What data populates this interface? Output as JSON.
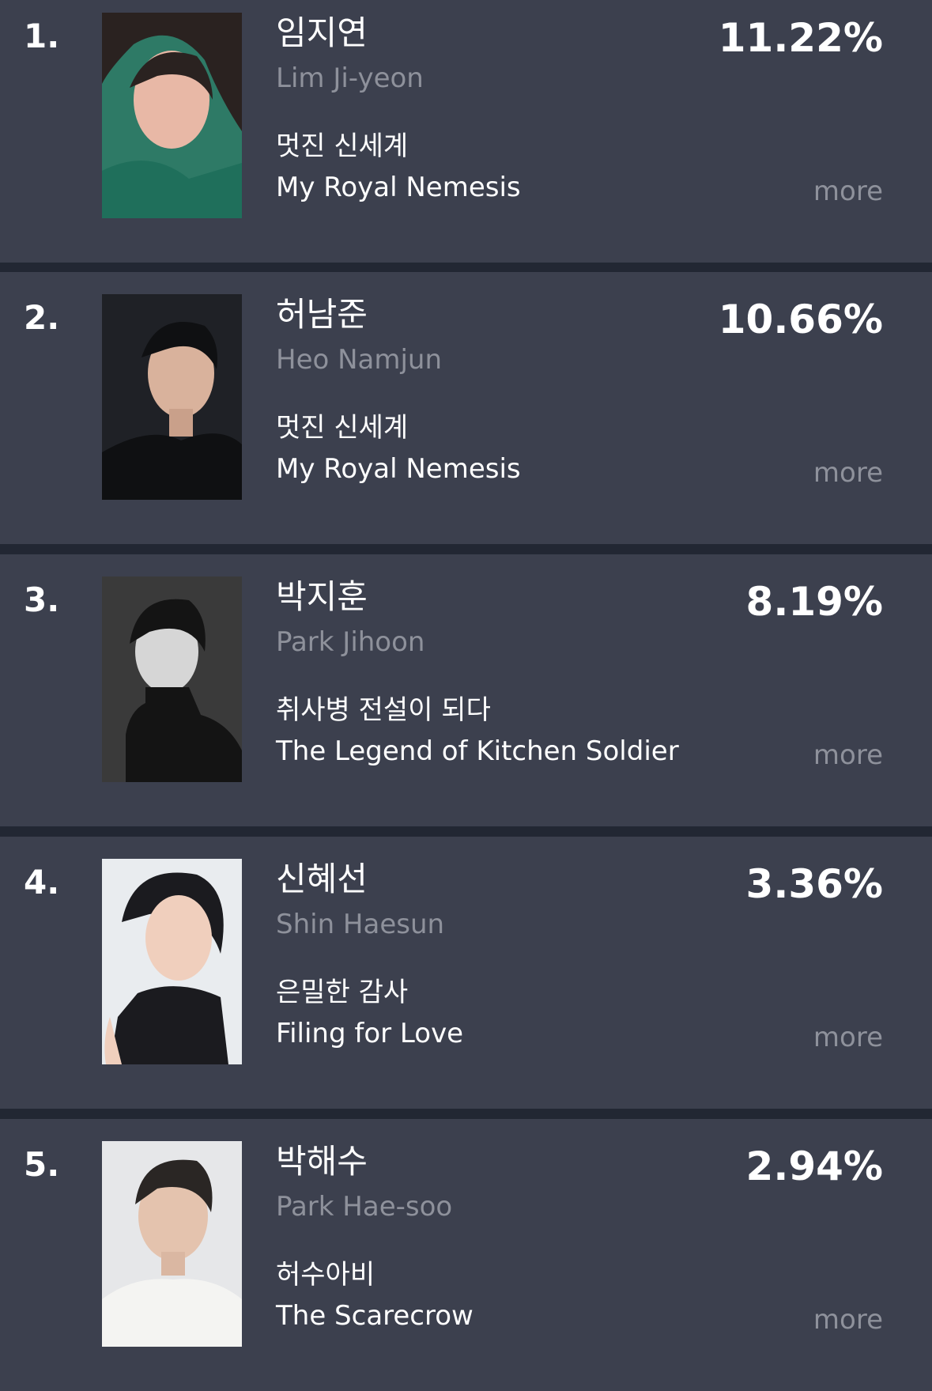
{
  "ranking": [
    {
      "rank": "1.",
      "name_ko": "임지연",
      "name_en": "Lim Ji-yeon",
      "show_ko": "멋진 신세계",
      "show_en": "My Royal Nemesis",
      "percent": "11.22%",
      "more": "more",
      "photo_bg": "#2e7a66",
      "photo_subject": "#2a2220"
    },
    {
      "rank": "2.",
      "name_ko": "허남준",
      "name_en": "Heo Namjun",
      "show_ko": "멋진 신세계",
      "show_en": "My Royal Nemesis",
      "percent": "10.66%",
      "more": "more",
      "photo_bg": "#1f2126",
      "photo_subject": "#0f1012"
    },
    {
      "rank": "3.",
      "name_ko": "박지훈",
      "name_en": "Park Jihoon",
      "show_ko": "취사병 전설이 되다",
      "show_en": "The Legend of Kitchen Soldier",
      "percent": "8.19%",
      "more": "more",
      "photo_bg": "#3a3a3a",
      "photo_subject": "#141414"
    },
    {
      "rank": "4.",
      "name_ko": "신혜선",
      "name_en": "Shin Haesun",
      "show_ko": "은밀한 감사",
      "show_en": "Filing for Love",
      "percent": "3.36%",
      "more": "more",
      "photo_bg": "#e9ecef",
      "photo_subject": "#1b1b1f"
    },
    {
      "rank": "5.",
      "name_ko": "박해수",
      "name_en": "Park Hae-soo",
      "show_ko": "허수아비",
      "show_en": "The Scarecrow",
      "percent": "2.94%",
      "more": "more",
      "photo_bg": "#e6e7e9",
      "photo_subject": "#f4f4f2"
    }
  ]
}
